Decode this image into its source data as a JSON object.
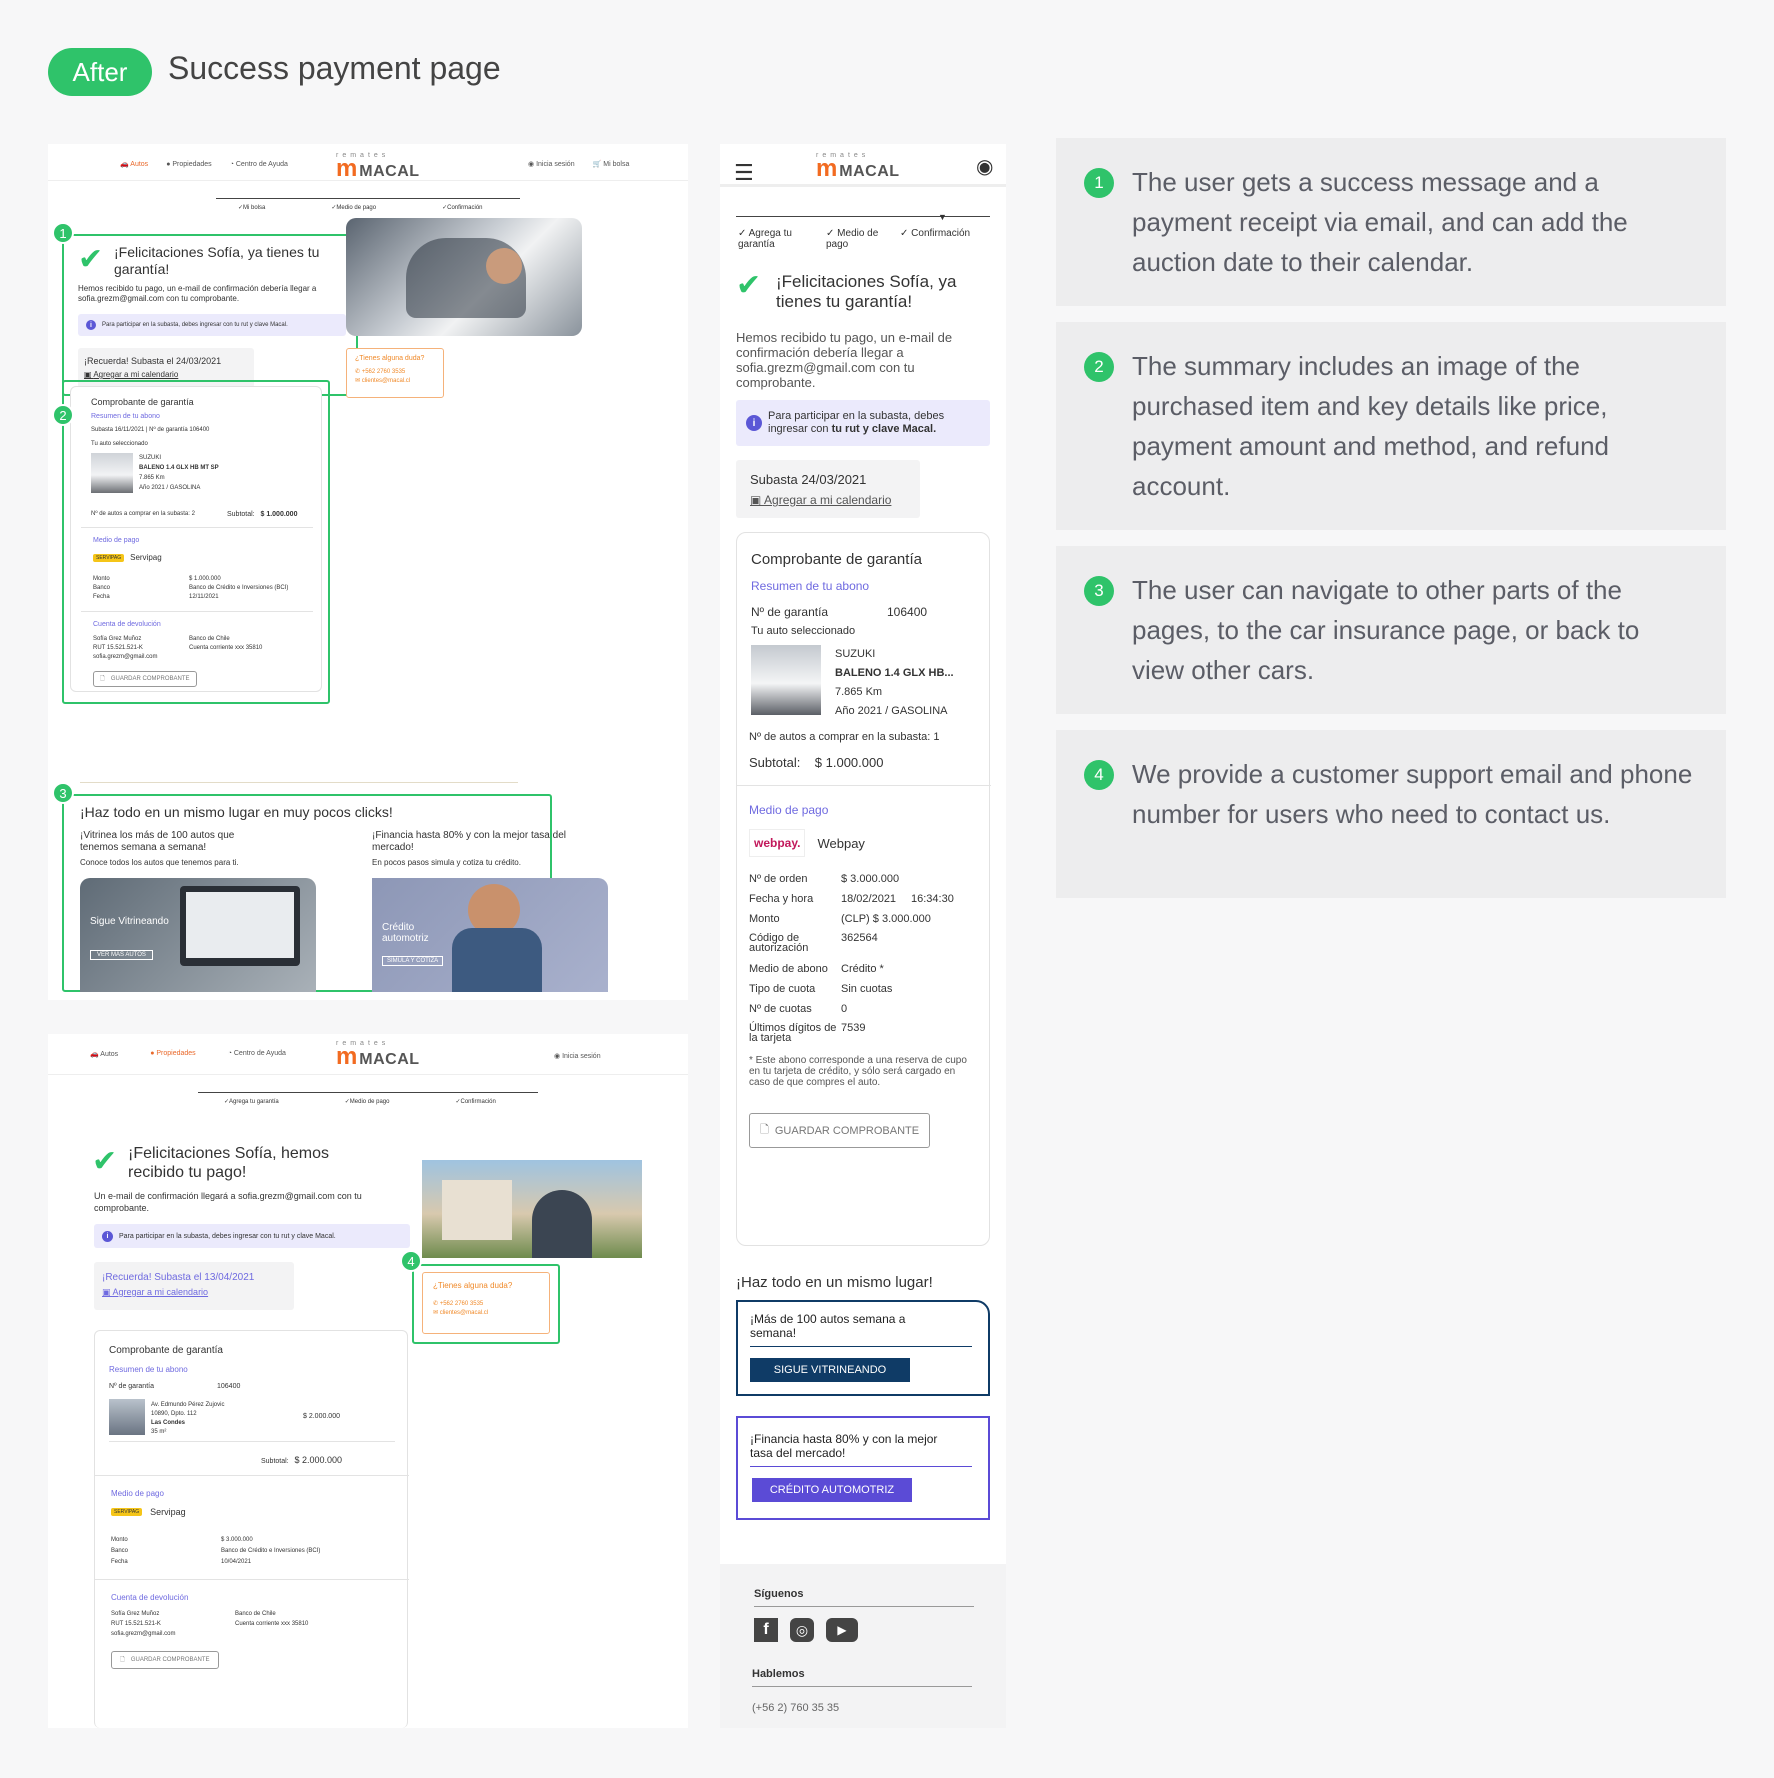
{
  "header": {
    "badge": "After",
    "title": "Success payment page"
  },
  "colors": {
    "green": "#2fc36a",
    "orange": "#f26b21",
    "purple": "#6f6ae0",
    "navy": "#0f3b66",
    "indigo": "#5b4bd6"
  },
  "logo": {
    "small": "remates",
    "main": "MACAL"
  },
  "notes": [
    {
      "num": "1",
      "text": "The user gets a success message and a payment receipt via email, and can add the auction date to their calendar."
    },
    {
      "num": "2",
      "text": "The summary includes an image of the purchased item and key details like price, payment amount and method, and refund account."
    },
    {
      "num": "3",
      "text": "The user can navigate to other parts of the pages, to the car insurance page, or back to view other cars."
    },
    {
      "num": "4",
      "text": "We provide a customer support email and phone number for users who need to contact us."
    }
  ],
  "markers": {
    "m1": "1",
    "m2": "2",
    "m3": "3",
    "m4": "4"
  },
  "desktop1": {
    "nav": {
      "autos": "Autos",
      "propiedades": "Propiedades",
      "ayuda": "Centro de Ayuda",
      "login": "Inicia sesión",
      "bolsa": "Mi bolsa"
    },
    "steps": [
      "Mi bolsa",
      "Medio de pago",
      "Confirmación"
    ],
    "success_title": "¡Felicitaciones Sofía, ya tienes tu garantía!",
    "success_body": "Hemos recibido tu pago, un e-mail de confirmación debería llegar a sofia.grezm@gmail.com con tu comprobante.",
    "info": "Para participar en la subasta, debes ingresar con tu rut y clave Macal.",
    "reminder": "¡Recuerda! Subasta el 24/03/2021",
    "calendar": "Agregar a mi calendario",
    "help": {
      "title": "¿Tienes alguna duda?",
      "phone": "+562 2760 3535",
      "email": "clientes@macal.cl"
    },
    "receipt": {
      "title": "Comprobante de garantía",
      "summary": "Resumen de tu abono",
      "meta": "Subasta 16/11/2021  |  Nº de garantía 106400",
      "selected": "Tu auto seleccionado",
      "car": [
        "SUZUKI",
        "BALENO 1.4 GLX HB MT SP",
        "7.865 Km",
        "Año 2021 / GASOLINA"
      ],
      "count": "Nº de autos a comprar en la subasta: 2",
      "subtotal_label": "Subtotal:",
      "subtotal": "$ 1.000.000",
      "pay_title": "Medio de pago",
      "pay_method": "Servipag",
      "pay_logo": "SERVIPAG",
      "pay_rows": [
        [
          "Monto",
          "$ 1.000.000"
        ],
        [
          "Banco",
          "Banco de Crédito e Inversiones (BCI)"
        ],
        [
          "Fecha",
          "12/11/2021"
        ]
      ],
      "refund_title": "Cuenta de devolución",
      "refund_left": [
        "Sofía Grez Muñoz",
        "RUT 15.521.521-K",
        "sofia.grezm@gmail.com"
      ],
      "refund_right": [
        "Banco de Chile",
        "Cuenta corriente xxx 35810"
      ],
      "save": "GUARDAR COMPROBANTE"
    },
    "cross": {
      "title": "¡Haz todo en un mismo lugar en muy pocos clicks!",
      "left_title": "¡Vitrinea los más de 100 autos que tenemos semana a semana!",
      "left_sub": "Conoce todos los autos que tenemos para ti.",
      "left_label": "Sigue Vitrineando",
      "left_btn": "VER MÁS AUTOS",
      "right_title": "¡Financia hasta 80% y con la mejor tasa del mercado!",
      "right_sub": "En pocos pasos simula y cotiza tu crédito.",
      "right_label": "Crédito automotriz",
      "right_btn": "SIMULA Y COTIZA"
    }
  },
  "desktop2": {
    "nav": {
      "autos": "Autos",
      "propiedades": "Propiedades",
      "ayuda": "Centro de Ayuda",
      "login": "Inicia sesión"
    },
    "steps": [
      "Agrega tu garantía",
      "Medio de pago",
      "Confirmación"
    ],
    "success_title": "¡Felicitaciones Sofía, hemos recibido tu pago!",
    "success_body": "Un e-mail de confirmación llegará a sofia.grezm@gmail.com con tu comprobante.",
    "info": "Para participar en la subasta, debes ingresar con tu rut y clave Macal.",
    "reminder": "¡Recuerda! Subasta el 13/04/2021",
    "calendar": "Agregar a mi calendario",
    "help": {
      "title": "¿Tienes alguna duda?",
      "phone": "+562 2760 3535",
      "email": "clientes@macal.cl"
    },
    "receipt": {
      "title": "Comprobante de garantía",
      "summary": "Resumen de tu abono",
      "g_label": "Nº de garantía",
      "g_value": "106400",
      "prop": [
        "Av. Edmundo Pérez Zujovic",
        "10890, Dpto. 112",
        "Las Condes",
        "35 m²"
      ],
      "price": "$ 2.000.000",
      "subtotal_label": "Subtotal:",
      "subtotal": "$ 2.000.000",
      "pay_title": "Medio de pago",
      "pay_method": "Servipag",
      "pay_logo": "SERVIPAG",
      "pay_rows": [
        [
          "Monto",
          "$ 3.000.000"
        ],
        [
          "Banco",
          "Banco de Crédito e Inversiones (BCI)"
        ],
        [
          "Fecha",
          "10/04/2021"
        ]
      ],
      "refund_title": "Cuenta de devolución",
      "refund_left": [
        "Sofía Grez Muñoz",
        "RUT 15.521.521-K",
        "sofia.grezm@gmail.com"
      ],
      "refund_right": [
        "Banco de Chile",
        "Cuenta corriente xxx 35810"
      ],
      "save": "GUARDAR COMPROBANTE"
    }
  },
  "mobile": {
    "steps": [
      "Agrega tu garantía",
      "Medio de pago",
      "Confirmación"
    ],
    "success_title": "¡Felicitaciones Sofía, ya tienes tu garantía!",
    "success_body": "Hemos recibido tu pago, un e-mail de confirmación debería llegar a sofia.grezm@gmail.com con tu comprobante.",
    "info_pre": "Para participar en la subasta, debes ingresar con ",
    "info_bold": "tu rut y clave Macal.",
    "reminder": "Subasta 24/03/2021",
    "calendar": "Agregar a mi calendario",
    "receipt": {
      "title": "Comprobante de garantía",
      "summary": "Resumen de tu abono",
      "g_label": "Nº de garantía",
      "g_value": "106400",
      "selected": "Tu auto seleccionado",
      "car": [
        "SUZUKI",
        "BALENO 1.4 GLX HB...",
        "7.865 Km",
        "Año 2021 / GASOLINA"
      ],
      "count": "Nº de autos a comprar en la subasta: 1",
      "subtotal_label": "Subtotal:",
      "subtotal": "$ 1.000.000",
      "pay_title": "Medio de pago",
      "pay_logo": "webpay.",
      "pay_method": "Webpay",
      "pay_rows": [
        [
          "Nº de orden",
          "$ 3.000.000",
          ""
        ],
        [
          "Fecha y hora",
          "18/02/2021",
          "16:34:30"
        ],
        [
          "Monto",
          "(CLP) $ 3.000.000",
          ""
        ],
        [
          "Código de autorización",
          "362564",
          ""
        ],
        [
          "Medio de abono",
          "Crédito *",
          ""
        ],
        [
          "Tipo de cuota",
          "Sin cuotas",
          ""
        ],
        [
          "Nº de cuotas",
          "0",
          ""
        ],
        [
          "Últimos dígitos de la tarjeta",
          "7539",
          ""
        ]
      ],
      "footnote": "* Este abono corresponde a una reserva de cupo en tu tarjeta de crédito, y sólo será cargado en caso de que compres el auto.",
      "save": "GUARDAR COMPROBANTE"
    },
    "cross_title": "¡Haz todo en un mismo lugar!",
    "promo1": {
      "text": "¡Más de 100 autos semana a semana!",
      "btn": "SIGUE VITRINEANDO"
    },
    "promo2": {
      "text": "¡Financia hasta 80% y con la mejor tasa del mercado!",
      "btn": "CRÉDITO AUTOMOTRIZ"
    },
    "footer": {
      "follow": "Síguenos",
      "talk": "Hablemos",
      "phone": "(+56 2) 760 35 35"
    }
  }
}
